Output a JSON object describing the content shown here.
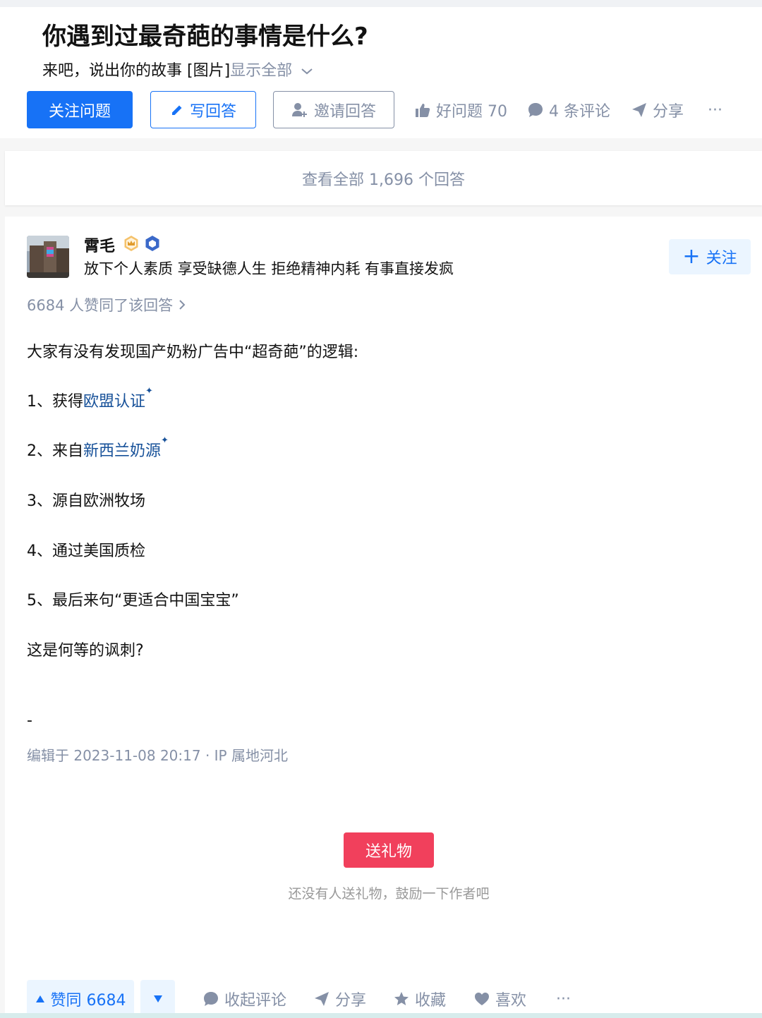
{
  "question": {
    "title": "你遇到过最奇葩的事情是什么?",
    "detail": "来吧，说出你的故事 [图片]",
    "show_all": "显示全部",
    "follow_button": "关注问题",
    "write_button": "写回答",
    "invite_button": "邀请回答",
    "good_question": "好问题 70",
    "comments": "4 条评论",
    "share": "分享",
    "more": "···"
  },
  "view_all_answers": "查看全部 1,696 个回答",
  "answer": {
    "author_name": "霄毛",
    "author_bio": "放下个人素质 享受缺德人生 拒绝精神内耗 有事直接发疯",
    "follow_button": "关注",
    "vote_summary": "6684 人赞同了该回答",
    "intro": "大家有没有发现国产奶粉广告中“超奇葩”的逻辑:",
    "item1_prefix": "1、获得",
    "item1_link": "欧盟认证",
    "item2_prefix": "2、来自",
    "item2_link": "新西兰奶源",
    "item3": "3、源自欧洲牧场",
    "item4": "4、通过美国质检",
    "item5": "5、最后来句“更适合中国宝宝”",
    "conclusion": "这是何等的讽刺?",
    "dash": "-",
    "edit_time": "编辑于 2023-11-08 20:17 · IP 属地河北",
    "gift_button": "送礼物",
    "gift_tip": "还没有人送礼物，鼓励一下作者吧",
    "vote_up": "赞同 6684",
    "collapse_comments": "收起评论",
    "share": "分享",
    "collect": "收藏",
    "like": "喜欢",
    "more": "···"
  },
  "colors": {
    "brand_blue": "#1772f6",
    "link_blue": "#175199",
    "meta_gray": "#8590a6",
    "gift_red": "#f1405c"
  }
}
